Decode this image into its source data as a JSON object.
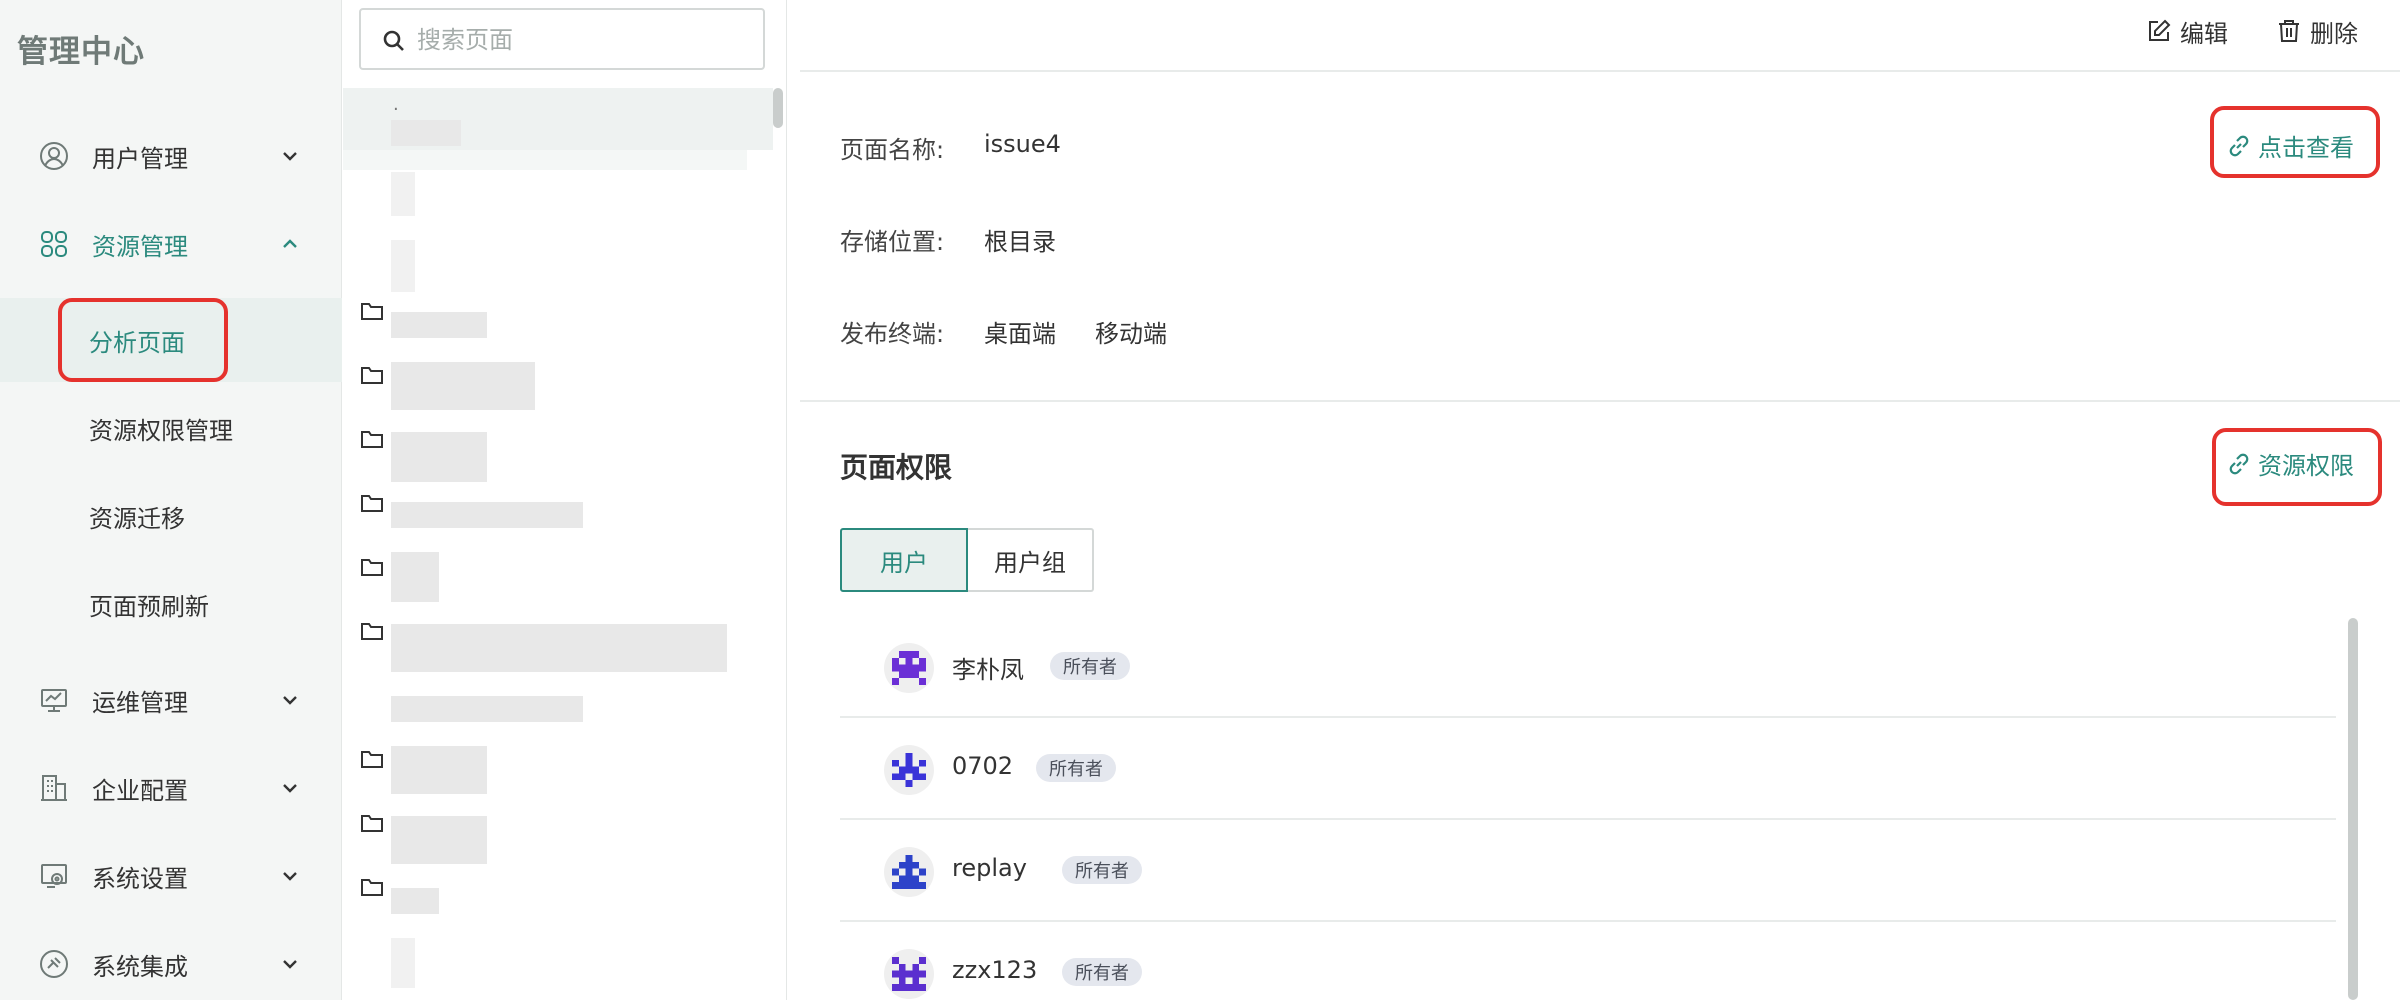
{
  "app": {
    "title": "管理中心"
  },
  "sidebar": {
    "menus": [
      {
        "label": "用户管理",
        "icon": "user-circle-icon",
        "expanded": false
      },
      {
        "label": "资源管理",
        "icon": "grid-icon",
        "expanded": true
      },
      {
        "label": "运维管理",
        "icon": "monitor-icon",
        "expanded": false
      },
      {
        "label": "企业配置",
        "icon": "building-icon",
        "expanded": false
      },
      {
        "label": "系统设置",
        "icon": "settings-icon",
        "expanded": false
      },
      {
        "label": "系统集成",
        "icon": "integration-icon",
        "expanded": false
      }
    ],
    "submenu": [
      {
        "label": "分析页面",
        "selected": true
      },
      {
        "label": "资源权限管理",
        "selected": false
      },
      {
        "label": "资源迁移",
        "selected": false
      },
      {
        "label": "页面预刷新",
        "selected": false
      }
    ]
  },
  "tree": {
    "search_placeholder": "搜索页面",
    "search_value": "",
    "dot": "."
  },
  "toolbar": {
    "edit": "编辑",
    "delete": "删除"
  },
  "details": {
    "name_label": "页面名称:",
    "name_value": "issue4",
    "view_link": "点击查看",
    "location_label": "存储位置:",
    "location_value": "根目录",
    "terminal_label": "发布终端:",
    "terminals": [
      "桌面端",
      "移动端"
    ]
  },
  "permissions": {
    "title": "页面权限",
    "resource_link": "资源权限",
    "tabs": [
      {
        "label": "用户",
        "active": true
      },
      {
        "label": "用户组",
        "active": false
      }
    ],
    "users": [
      {
        "name": "李朴凤",
        "role": "所有者",
        "avatar_color": "#6b2fd6"
      },
      {
        "name": "0702",
        "role": "所有者",
        "avatar_color": "#3a33d8"
      },
      {
        "name": "replay",
        "role": "所有者",
        "avatar_color": "#2d43c9"
      },
      {
        "name": "zzx123",
        "role": "所有者",
        "avatar_color": "#5b2fcf"
      }
    ]
  },
  "colors": {
    "accent": "#2b8a7e",
    "highlight": "#e5322d",
    "badge_bg": "#e4e7ee"
  }
}
